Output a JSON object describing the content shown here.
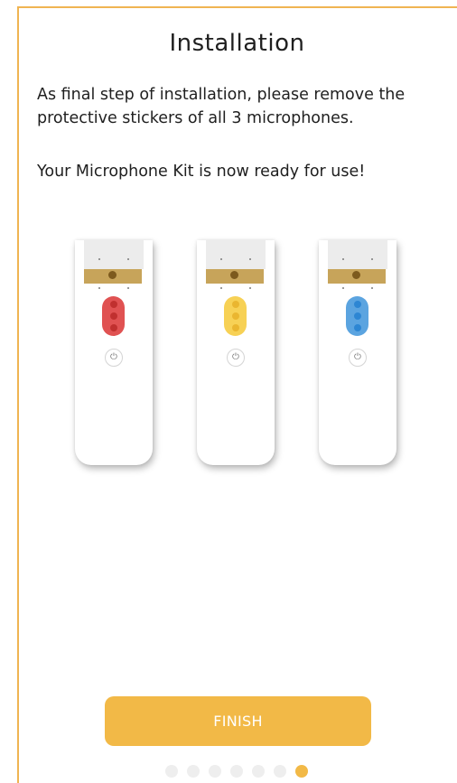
{
  "page": {
    "title": "Installation",
    "paragraph1": "As final step of installation, please remove the protective stickers of all 3 microphones.",
    "paragraph2": "Your Microphone Kit is now ready for use!"
  },
  "microphones": [
    {
      "color_name": "red",
      "light_color": "#e05252",
      "led_color": "#c0302f"
    },
    {
      "color_name": "yellow",
      "light_color": "#f7d155",
      "led_color": "#eab630"
    },
    {
      "color_name": "blue",
      "light_color": "#5ba4e0",
      "led_color": "#2d86d3"
    }
  ],
  "power_icon": "power-icon",
  "finish_button": {
    "label": "FINISH",
    "color": "#f2b947"
  },
  "pager": {
    "total": 7,
    "active_index": 6,
    "active_color": "#f2b947",
    "inactive_color": "#eeeeee"
  },
  "frame_color": "#f0b452"
}
